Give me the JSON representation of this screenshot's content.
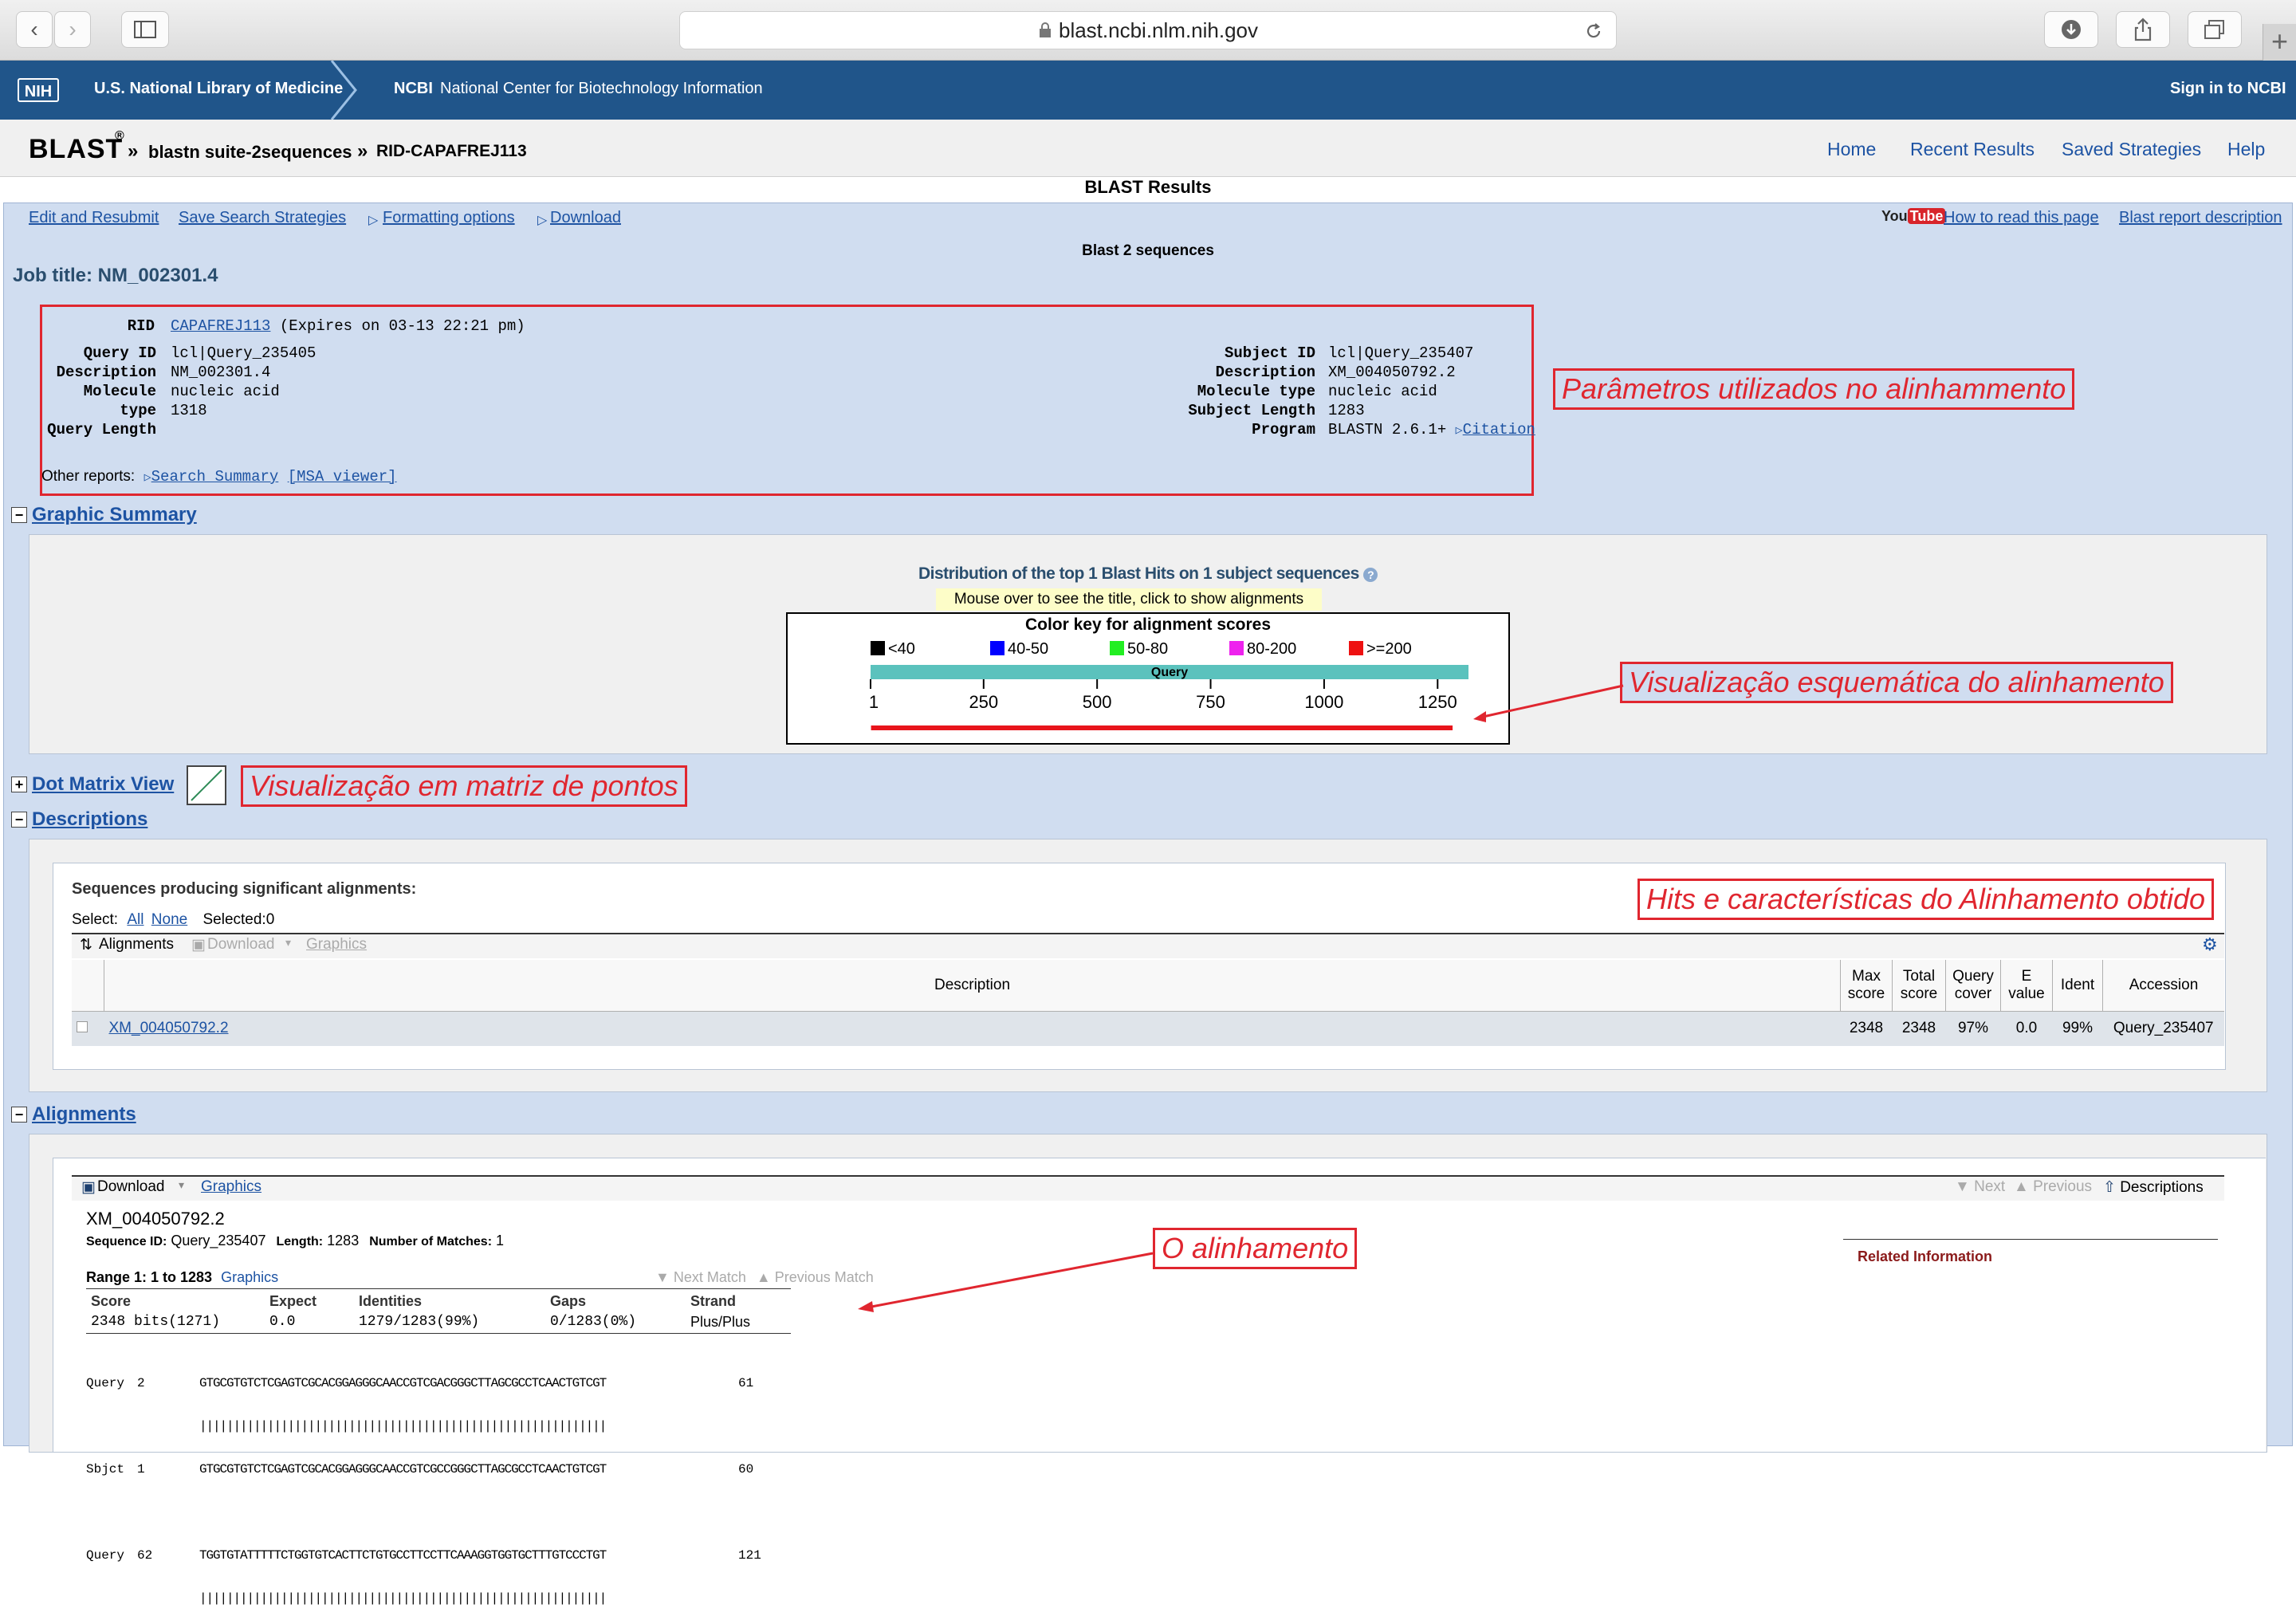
{
  "browser": {
    "url": "blast.ncbi.nlm.nih.gov",
    "new_tab": "+"
  },
  "ncbi_header": {
    "nih_logo": "NIH",
    "nlm": "U.S. National Library of Medicine",
    "ncbi_abbr": "NCBI",
    "ncbi_full": "National Center for Biotechnology Information",
    "sign_in": "Sign in to NCBI"
  },
  "blast_bar": {
    "logo": "BLAST",
    "reg": "®",
    "sep": "»",
    "crumb1": "blastn suite-2sequences",
    "crumb2": "RID-CAPAFREJ113",
    "nav": [
      "Home",
      "Recent Results",
      "Saved Strategies",
      "Help"
    ]
  },
  "results": {
    "title": "BLAST Results",
    "links": [
      "Edit and Resubmit",
      "Save Search Strategies",
      "Formatting options",
      "Download"
    ],
    "youtube": "YouTube",
    "right_links": [
      "How to read this page",
      "Blast report description"
    ],
    "subtitle": "Blast 2 sequences",
    "job_title": "Job title: NM_002301.4"
  },
  "params": {
    "rid_label": "RID",
    "rid_value": "CAPAFREJ113",
    "rid_expires": "(Expires on 03-13 22:21 pm)",
    "query_labels": [
      "Query ID",
      "Description",
      "Molecule type",
      "Query Length"
    ],
    "query_values": [
      "lcl|Query_235405",
      "NM_002301.4",
      "nucleic acid",
      "1318"
    ],
    "subject_labels": [
      "Subject ID",
      "Description",
      "Molecule type",
      "Subject Length",
      "Program"
    ],
    "subject_values": [
      "lcl|Query_235407",
      "XM_004050792.2",
      "nucleic acid",
      "1283",
      "BLASTN 2.6.1+"
    ],
    "citation": "Citation",
    "other_reports": "Other reports:",
    "search_summary": "Search Summary",
    "msa_viewer": "[MSA viewer]"
  },
  "annotations": {
    "params": "Parâmetros utilizados no alinhammento",
    "schematic": "Visualização esquemática do alinhamento",
    "dotmatrix": "Visualização em matriz de pontos",
    "hits": "Hits e características do Alinhamento obtido",
    "alignment": "O alinhamento"
  },
  "graphic_summary": {
    "header": "Graphic Summary",
    "distribution": "Distribution of the top 1 Blast Hits on 1 subject sequences",
    "help_icon": "?",
    "mouseover": "Mouse over to see the title, click to show alignments",
    "color_key_title": "Color key for alignment scores",
    "color_key": [
      {
        "label": "<40",
        "color": "#000000"
      },
      {
        "label": "40-50",
        "color": "#0000ff"
      },
      {
        "label": "50-80",
        "color": "#22ee22"
      },
      {
        "label": "80-200",
        "color": "#ee22ee"
      },
      {
        "label": ">=200",
        "color": "#ee1111"
      }
    ],
    "query_label": "Query",
    "ticks": [
      "1",
      "250",
      "500",
      "750",
      "1000",
      "1250"
    ],
    "query_length": 1318,
    "hit_start": 2,
    "hit_end": 1283,
    "hit_color": "#e8141b",
    "query_bar_color": "#5bc2bd"
  },
  "dot_matrix": {
    "header": "Dot Matrix View"
  },
  "descriptions": {
    "header": "Descriptions",
    "seq_title": "Sequences producing significant alignments:",
    "select_label": "Select:",
    "all": "All",
    "none": "None",
    "selected": "Selected:0",
    "toolbar": [
      "Alignments",
      "Download",
      "Graphics"
    ],
    "columns": [
      "Description",
      "Max score",
      "Total score",
      "Query cover",
      "E value",
      "Ident",
      "Accession"
    ],
    "columns_line1": [
      "Max",
      "Total",
      "Query",
      "E"
    ],
    "columns_line2": [
      "score",
      "score",
      "cover",
      "value"
    ],
    "rows": [
      {
        "description": "XM_004050792.2",
        "max": "2348",
        "total": "2348",
        "cover": "97%",
        "evalue": "0.0",
        "ident": "99%",
        "accession": "Query_235407"
      }
    ]
  },
  "alignments": {
    "header": "Alignments",
    "toolbar": [
      "Download",
      "Graphics"
    ],
    "nav": [
      "Next",
      "Previous",
      "Descriptions"
    ],
    "accession": "XM_004050792.2",
    "seqid_label": "Sequence ID:",
    "seqid": "Query_235407",
    "length_label": "Length:",
    "length": "1283",
    "matches_label": "Number of Matches:",
    "matches": "1",
    "related": "Related Information",
    "range": "Range 1: 1 to 1283",
    "range_graphics": "Graphics",
    "next_match": "Next Match",
    "prev_match": "Previous Match",
    "stats_headers": [
      "Score",
      "Expect",
      "Identities",
      "Gaps",
      "Strand"
    ],
    "stats_values": [
      "2348 bits(1271)",
      "0.0",
      "1279/1283(99%)",
      "0/1283(0%)",
      "Plus/Plus"
    ],
    "lines": [
      {
        "label": "Query",
        "start": "2",
        "seq": "GTGCGTGTCTCGAGTCGCACGGAGGGCAACCGTCGACGGGCTTAGCGCCTCAACTGTCGT",
        "end": "61"
      },
      {
        "label": "",
        "start": "",
        "seq": "||||||||||||||||||||||||||||||||||||||||||||||||||||||||||||",
        "end": ""
      },
      {
        "label": "Sbjct",
        "start": "1",
        "seq": "GTGCGTGTCTCGAGTCGCACGGAGGGCAACCGTCGCCGGGCTTAGCGCCTCAACTGTCGT",
        "end": "60"
      },
      {
        "label": "Query",
        "start": "62",
        "seq": "TGGTGTATTTTTCTGGTGTCACTTCTGTGCCTTCCTTCAAAGGTGGTGCTTTGTCCCTGT",
        "end": "121"
      },
      {
        "label": "",
        "start": "",
        "seq": "||||||||||||||||||||||||||||||||||||||||||||||||||||||||||||",
        "end": ""
      }
    ]
  }
}
